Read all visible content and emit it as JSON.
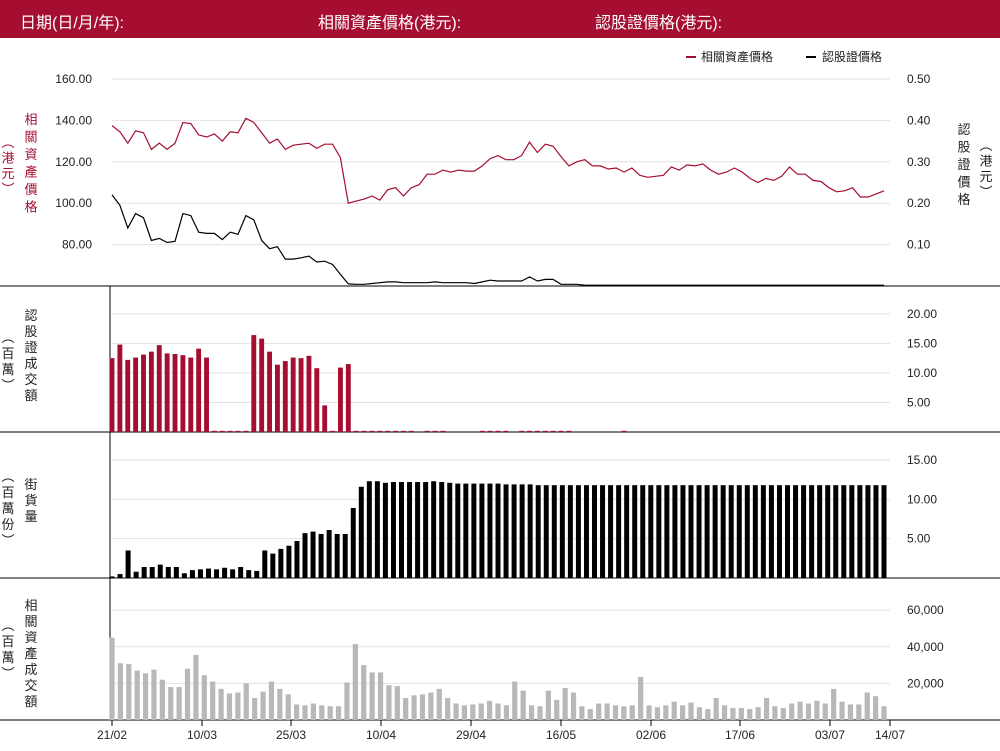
{
  "header": {
    "date_label": "日期(日/月/年):",
    "asset_price_label": "相關資產價格(港元):",
    "warrant_price_label": "認股證價格(港元):"
  },
  "colors": {
    "header_bg": "#a50e31",
    "asset": "#a50e31",
    "warrant": "#000000",
    "asset_turnover": "#b8b8b8",
    "grid": "#e2e2e2"
  },
  "chart_data": [
    {
      "type": "line",
      "legend": [
        "相關資產價格",
        "認股證價格"
      ],
      "legend_position": "top-right",
      "left_axis": {
        "label": "相關資產價格",
        "unit": "（港元）",
        "ticks": [
          "160.00",
          "140.00",
          "120.00",
          "100.00",
          "80.00"
        ],
        "ylim": [
          60,
          160
        ]
      },
      "right_axis": {
        "label": "認股證價格",
        "unit": "（港元）",
        "ticks": [
          "0.50",
          "0.40",
          "0.30",
          "0.20",
          "0.10"
        ],
        "ylim": [
          0,
          0.5
        ]
      },
      "series": [
        {
          "name": "相關資產價格",
          "axis": "left",
          "values": [
            137.5,
            134.5,
            129,
            135,
            134,
            126,
            129,
            126,
            129,
            139,
            138.5,
            133,
            132,
            133.5,
            130,
            134.5,
            134,
            141,
            139,
            134,
            129,
            131,
            126,
            128,
            128.5,
            129,
            126.5,
            128.5,
            128.5,
            122,
            100,
            101,
            102,
            103.5,
            101.5,
            106.5,
            107.5,
            103.5,
            107.5,
            109,
            114,
            114,
            116,
            115,
            116,
            115.5,
            115.5,
            118,
            121.5,
            123,
            121,
            121,
            123,
            129.5,
            124.5,
            128.5,
            127.5,
            122.5,
            118,
            120,
            121,
            118,
            118,
            116.5,
            117,
            115,
            117,
            113.5,
            112.5,
            113,
            113.5,
            117.5,
            116,
            118.5,
            118,
            119,
            116,
            114,
            115,
            117,
            115,
            112,
            110,
            112,
            111,
            113,
            117.5,
            114,
            114,
            111,
            110.5,
            107.5,
            105.5,
            106,
            107.5,
            103,
            103,
            104.5,
            106
          ]
        },
        {
          "name": "認股證價格",
          "axis": "right",
          "values": [
            0.22,
            0.195,
            0.14,
            0.175,
            0.165,
            0.11,
            0.115,
            0.105,
            0.108,
            0.175,
            0.17,
            0.13,
            0.127,
            0.127,
            0.112,
            0.13,
            0.125,
            0.17,
            0.16,
            0.11,
            0.09,
            0.095,
            0.065,
            0.065,
            0.068,
            0.072,
            0.058,
            0.06,
            0.052,
            0.028,
            0.005,
            0.004,
            0.004,
            0.006,
            0.008,
            0.01,
            0.01,
            0.008,
            0.008,
            0.008,
            0.008,
            0.01,
            0.008,
            0.008,
            0.008,
            0.008,
            0.006,
            0.01,
            0.014,
            0.012,
            0.012,
            0.012,
            0.012,
            0.022,
            0.012,
            0.016,
            0.016,
            0.004,
            0.004,
            0.004,
            0.002,
            0.002,
            0.002,
            0.002,
            0.002,
            0.002,
            0.002,
            0.002,
            0.002,
            0.002,
            0.002,
            0.002,
            0.002,
            0.002,
            0.002,
            0.002,
            0.002,
            0.002,
            0.002,
            0.002,
            0.002,
            0.002,
            0.002,
            0.002,
            0.002,
            0.002,
            0.002,
            0.002,
            0.002,
            0.002,
            0.002,
            0.002,
            0.002,
            0.002,
            0.002,
            0.002,
            0.002,
            0.002,
            0.002
          ]
        }
      ]
    },
    {
      "type": "bar",
      "ylabel": "認股證成交額",
      "unit": "（百萬）",
      "ticks": [
        "20.00",
        "15.00",
        "10.00",
        "5.00"
      ],
      "ylim": [
        0,
        22
      ],
      "series": [
        {
          "name": "認股證成交額",
          "values": [
            12.5,
            14.8,
            12.2,
            12.6,
            13.1,
            13.6,
            14.7,
            13.3,
            13.2,
            13,
            12.6,
            14.1,
            12.6,
            0.2,
            0.2,
            0.2,
            0.2,
            0.2,
            16.4,
            15.8,
            13.6,
            11.4,
            12,
            12.6,
            12.5,
            12.9,
            10.8,
            4.5,
            0.2,
            10.9,
            11.5,
            0.2,
            0.2,
            0.2,
            0.2,
            0.2,
            0.2,
            0.2,
            0.2,
            0,
            0.2,
            0.2,
            0.2,
            0,
            0,
            0,
            0,
            0.2,
            0.2,
            0.2,
            0.2,
            0,
            0.2,
            0.2,
            0.2,
            0.2,
            0.2,
            0.2,
            0.2,
            0,
            0,
            0,
            0,
            0,
            0,
            0.2,
            0,
            0,
            0,
            0,
            0,
            0,
            0,
            0,
            0,
            0,
            0,
            0,
            0,
            0,
            0,
            0,
            0,
            0,
            0,
            0,
            0,
            0,
            0,
            0,
            0,
            0,
            0,
            0,
            0,
            0,
            0,
            0,
            0
          ]
        }
      ]
    },
    {
      "type": "bar",
      "ylabel": "街貨量",
      "unit": "（百萬份）",
      "ticks": [
        "15.00",
        "10.00",
        "5.00"
      ],
      "ylim": [
        0,
        15
      ],
      "series": [
        {
          "name": "街貨量",
          "values": [
            0.2,
            0.5,
            3.5,
            0.8,
            1.4,
            1.4,
            1.7,
            1.4,
            1.4,
            0.6,
            1,
            1.1,
            1.2,
            1.1,
            1.3,
            1.1,
            1.4,
            1,
            0.9,
            3.5,
            3.1,
            3.7,
            4.1,
            4.7,
            5.7,
            5.9,
            5.6,
            6.1,
            5.6,
            5.6,
            8.9,
            11.6,
            12.3,
            12.3,
            12.1,
            12.2,
            12.2,
            12.2,
            12.2,
            12.2,
            12.3,
            12.2,
            12.1,
            12,
            12,
            12,
            12,
            12,
            12,
            11.9,
            11.9,
            11.9,
            11.9,
            11.8,
            11.8,
            11.8,
            11.8,
            11.8,
            11.8,
            11.8,
            11.8,
            11.8,
            11.8,
            11.8,
            11.8,
            11.8,
            11.8,
            11.8,
            11.8,
            11.8,
            11.8,
            11.8,
            11.8,
            11.8,
            11.8,
            11.8,
            11.8,
            11.8,
            11.8,
            11.8,
            11.8,
            11.8,
            11.8,
            11.8,
            11.8,
            11.8,
            11.8,
            11.8,
            11.8,
            11.8,
            11.8,
            11.8,
            11.8,
            11.8,
            11.8,
            11.8,
            11.8
          ]
        }
      ]
    },
    {
      "type": "bar",
      "ylabel": "相關資產成交額",
      "unit": "（百萬）",
      "ticks": [
        "60,000",
        "40,000",
        "20,000"
      ],
      "ylim": [
        0,
        65000
      ],
      "x_ticks": [
        "21/02",
        "10/03",
        "25/03",
        "10/04",
        "29/04",
        "16/05",
        "02/06",
        "17/06",
        "03/07",
        "14/07"
      ],
      "series": [
        {
          "name": "相關資產成交額",
          "values": [
            45000,
            31000,
            30500,
            27000,
            25500,
            27500,
            22000,
            18000,
            18000,
            28000,
            35500,
            24500,
            21000,
            17000,
            14500,
            15000,
            20000,
            12000,
            15500,
            21000,
            17000,
            14000,
            8500,
            8000,
            9000,
            8000,
            7500,
            7500,
            20500,
            41500,
            30000,
            26000,
            26000,
            19000,
            18500,
            12000,
            13500,
            14000,
            15000,
            17000,
            12000,
            9000,
            8000,
            8500,
            9000,
            10500,
            9000,
            8000,
            21000,
            16000,
            8000,
            7500,
            16000,
            11000,
            17500,
            15000,
            7500,
            6000,
            9000,
            9000,
            8000,
            7500,
            8000,
            23500,
            8000,
            7000,
            8000,
            10000,
            8000,
            9500,
            7000,
            6000,
            12000,
            8000,
            6500,
            6500,
            6000,
            7000,
            12000,
            7500,
            6500,
            9000,
            10000,
            9000,
            10500,
            9000,
            17000,
            10000,
            8500,
            8500,
            15000,
            13000,
            7500
          ]
        }
      ]
    }
  ]
}
